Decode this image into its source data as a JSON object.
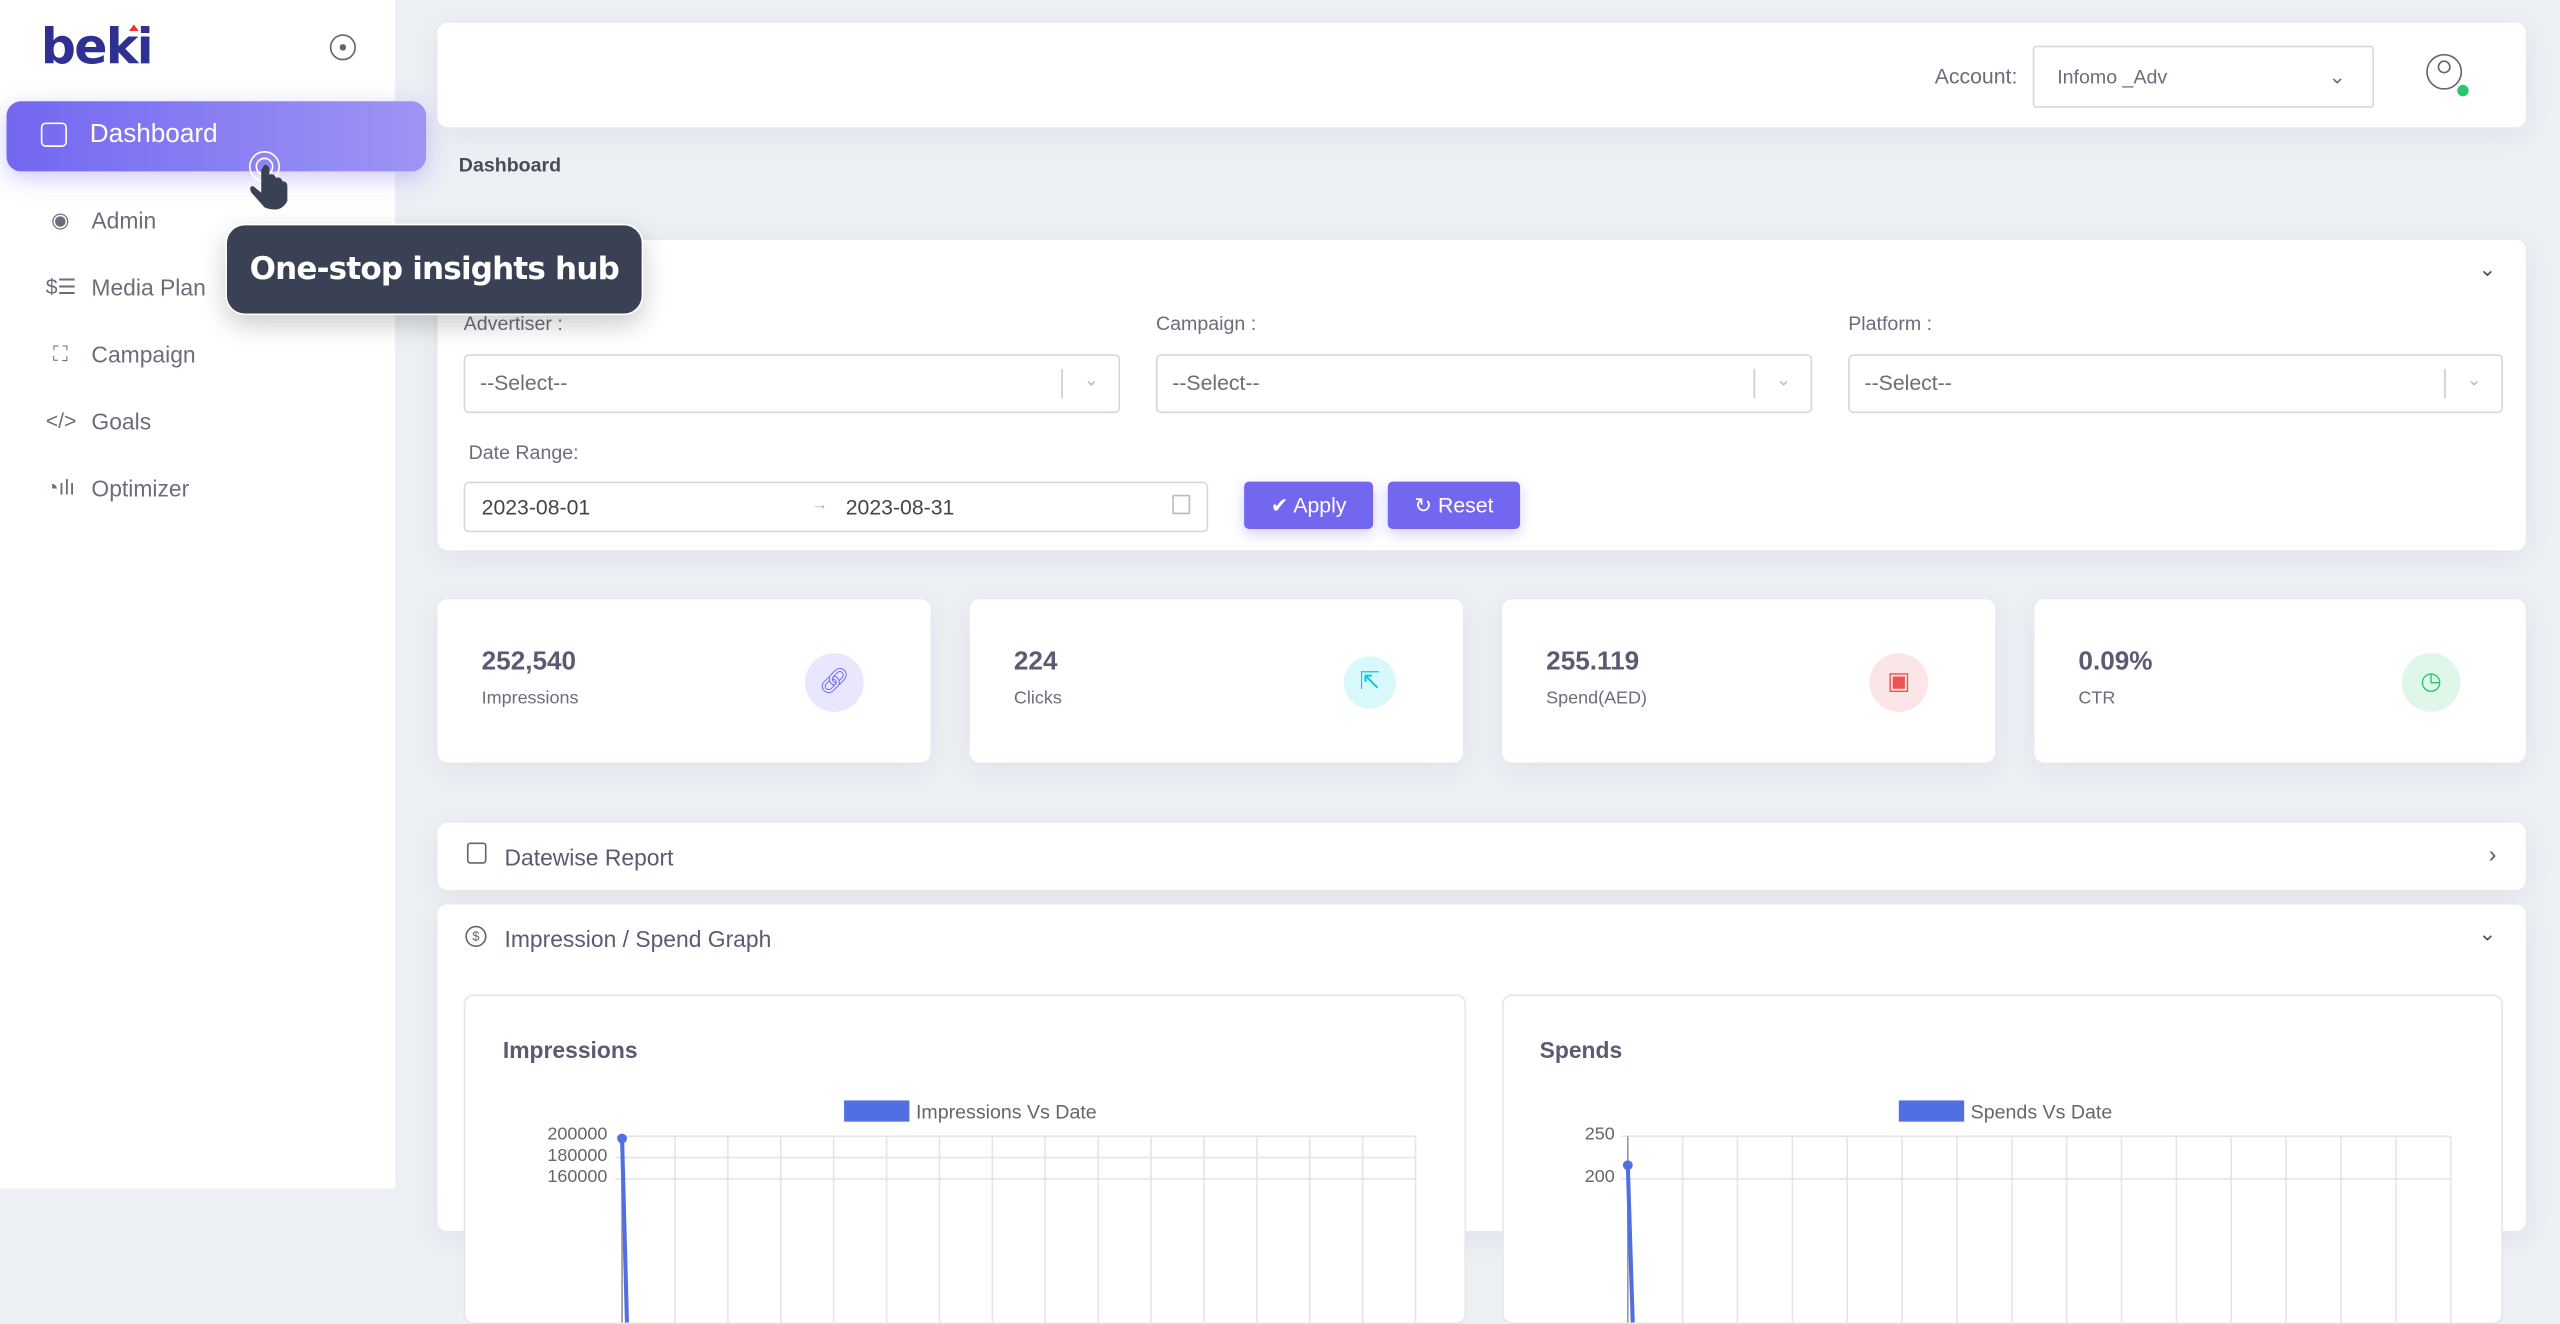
{
  "sidebar": {
    "logo": "beki",
    "items": [
      {
        "label": "Dashboard",
        "icon": "home-icon",
        "active": true
      },
      {
        "label": "Admin",
        "icon": "user-circle-icon"
      },
      {
        "label": "Media Plan",
        "icon": "dollar-database-icon"
      },
      {
        "label": "Campaign",
        "icon": "target-icon"
      },
      {
        "label": "Goals",
        "icon": "code-icon"
      },
      {
        "label": "Optimizer",
        "icon": "chart-bars-icon"
      }
    ]
  },
  "tooltip": {
    "text": "One-stop insights hub"
  },
  "header": {
    "account_label": "Account:",
    "account_value": "Infomo _Adv",
    "status_color": "#28c76f"
  },
  "breadcrumb": "Dashboard",
  "filters": {
    "advertiser_label": "Advertiser :",
    "campaign_label": "Campaign :",
    "platform_label": "Platform :",
    "select_placeholder": "--Select--",
    "date_range_label": "Date Range:",
    "date_start": "2023-08-01",
    "date_end": "2023-08-31",
    "apply": "Apply",
    "reset": "Reset"
  },
  "stats": [
    {
      "value": "252,540",
      "label": "Impressions",
      "icon": "link-icon",
      "color": "#7367f0",
      "bg": "#e9e7fd"
    },
    {
      "value": "224",
      "label": "Clicks",
      "icon": "cursor-click-icon",
      "color": "#00cfe8",
      "bg": "#d9f8fc"
    },
    {
      "value": "255.119",
      "label": "Spend(AED)",
      "icon": "wallet-icon",
      "color": "#ea5455",
      "bg": "#fce5e6"
    },
    {
      "value": "0.09%",
      "label": "CTR",
      "icon": "pie-chart-icon",
      "color": "#28c76f",
      "bg": "#dff7e9"
    }
  ],
  "sections": {
    "datewise": "Datewise Report",
    "graph": "Impression / Spend Graph"
  },
  "accent": "#7367f0",
  "chart_data": [
    {
      "type": "line",
      "title": "Impressions",
      "legend": "Impressions Vs Date",
      "yticks": [
        "200000",
        "180000",
        "160000"
      ],
      "ylim_visible": [
        160000,
        200000
      ],
      "series": [
        {
          "name": "Impressions Vs Date",
          "values": [
            198000
          ],
          "color": "#4f6fe3"
        }
      ],
      "grid": true,
      "legend_position": "top"
    },
    {
      "type": "line",
      "title": "Spends",
      "legend": "Spends Vs Date",
      "yticks": [
        "250",
        "200"
      ],
      "ylim_visible": [
        200,
        250
      ],
      "series": [
        {
          "name": "Spends Vs Date",
          "values": [
            216
          ],
          "color": "#4f6fe3"
        }
      ],
      "grid": true,
      "legend_position": "top"
    }
  ]
}
